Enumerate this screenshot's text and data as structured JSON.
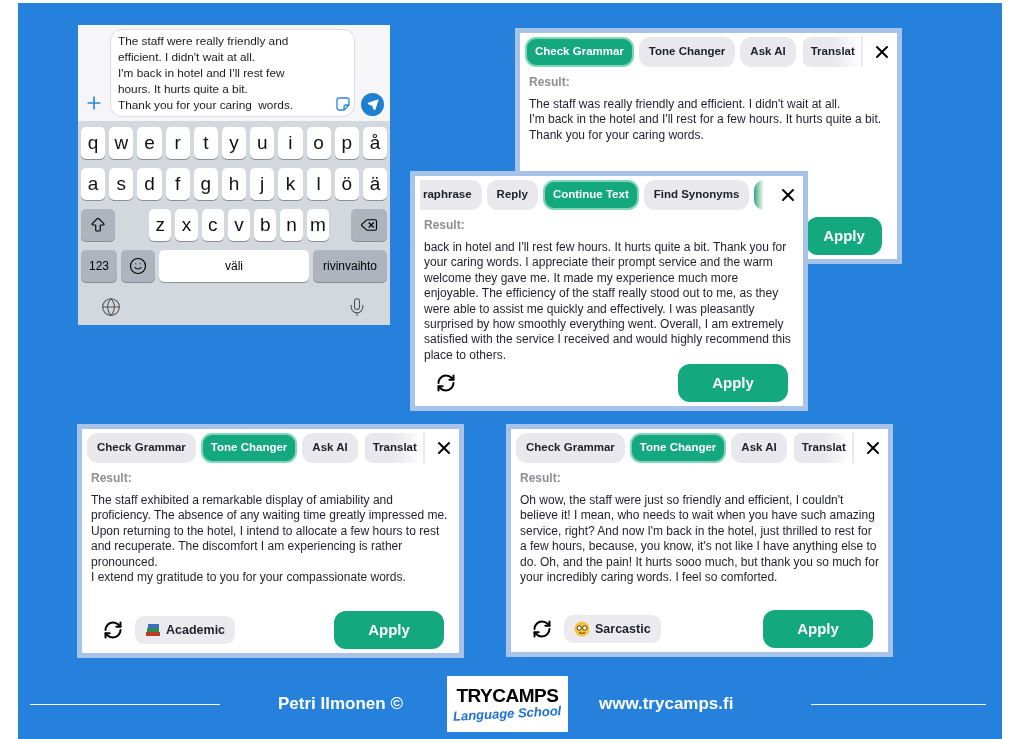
{
  "phone": {
    "message_lines": [
      "The staff were really friendly and",
      "efficient. I didn't wait at all.",
      "I'm back in hotel and I'll rest few",
      "hours. It hurts quite a bit.",
      "Thank you for your caring  words."
    ],
    "keyboard": [
      [
        {
          "kind": "letter",
          "label": "q"
        },
        {
          "kind": "letter",
          "label": "w"
        },
        {
          "kind": "letter",
          "label": "e"
        },
        {
          "kind": "letter",
          "label": "r"
        },
        {
          "kind": "letter",
          "label": "t"
        },
        {
          "kind": "letter",
          "label": "y"
        },
        {
          "kind": "letter",
          "label": "u"
        },
        {
          "kind": "letter",
          "label": "i"
        },
        {
          "kind": "letter",
          "label": "o"
        },
        {
          "kind": "letter",
          "label": "p"
        },
        {
          "kind": "letter",
          "label": "å"
        }
      ],
      [
        {
          "kind": "letter",
          "label": "a"
        },
        {
          "kind": "letter",
          "label": "s"
        },
        {
          "kind": "letter",
          "label": "d"
        },
        {
          "kind": "letter",
          "label": "f"
        },
        {
          "kind": "letter",
          "label": "g"
        },
        {
          "kind": "letter",
          "label": "h"
        },
        {
          "kind": "letter",
          "label": "j"
        },
        {
          "kind": "letter",
          "label": "k"
        },
        {
          "kind": "letter",
          "label": "l"
        },
        {
          "kind": "letter",
          "label": "ö"
        },
        {
          "kind": "letter",
          "label": "ä"
        }
      ],
      [
        {
          "kind": "shift"
        },
        {
          "kind": "letter",
          "label": "z"
        },
        {
          "kind": "letter",
          "label": "x"
        },
        {
          "kind": "letter",
          "label": "c"
        },
        {
          "kind": "letter",
          "label": "v"
        },
        {
          "kind": "letter",
          "label": "b"
        },
        {
          "kind": "letter",
          "label": "n"
        },
        {
          "kind": "letter",
          "label": "m"
        },
        {
          "kind": "backspace"
        }
      ],
      [
        {
          "kind": "numbers",
          "label": "123"
        },
        {
          "kind": "emoji"
        },
        {
          "kind": "space",
          "label": "väli"
        },
        {
          "kind": "return",
          "label": "rivinvaihto"
        }
      ]
    ]
  },
  "panels": [
    {
      "tabs": [
        {
          "label": "Check Grammar",
          "selected": true,
          "kind": "full"
        },
        {
          "label": "Tone Changer",
          "selected": false,
          "kind": "full"
        },
        {
          "label": "Ask AI",
          "selected": false,
          "kind": "full"
        },
        {
          "label": "Translat",
          "selected": false,
          "kind": "cut_right"
        }
      ],
      "result_label": "Result:",
      "result": "The staff was really friendly and efficient. I didn't wait at all.\nI'm back in the hotel and I'll rest for a few hours. It hurts quite a bit.\nThank you for your caring words.",
      "apply": "Apply"
    },
    {
      "tabs": [
        {
          "label": "raphrase",
          "selected": false,
          "kind": "cut_left"
        },
        {
          "label": "Reply",
          "selected": false,
          "kind": "full"
        },
        {
          "label": "Continue Text",
          "selected": true,
          "kind": "full"
        },
        {
          "label": "Find Synonyms",
          "selected": false,
          "kind": "full"
        }
      ],
      "result_label": "Result:",
      "result": "back in hotel and I'll rest few hours. It hurts quite a bit. Thank you for your caring words. I appreciate their prompt service and the warm welcome they gave me. It made my experience much more enjoyable. The efficiency of the staff really stood out to me, as they were able to assist me quickly and effectively. I was pleasantly surprised by how smoothly everything went. Overall, I am extremely satisfied with the service I received and would highly recommend this place to others.",
      "refresh": true,
      "apply": "Apply"
    },
    {
      "tabs": [
        {
          "label": "Check Grammar",
          "selected": false,
          "kind": "full"
        },
        {
          "label": "Tone Changer",
          "selected": true,
          "kind": "full"
        },
        {
          "label": "Ask AI",
          "selected": false,
          "kind": "full"
        },
        {
          "label": "Translat",
          "selected": false,
          "kind": "cut_right"
        }
      ],
      "result_label": "Result:",
      "result": "The staff exhibited a remarkable display of amiability and proficiency. The absence of any waiting time greatly impressed me. Upon returning to the hotel, I intend to allocate a few hours to rest and recuperate. The discomfort I am experiencing is rather pronounced.\nI extend my gratitude to you for your compassionate words.",
      "refresh": true,
      "tone": {
        "kind": "books",
        "label": "Academic"
      },
      "apply": "Apply"
    },
    {
      "tabs": [
        {
          "label": "Check Grammar",
          "selected": false,
          "kind": "full"
        },
        {
          "label": "Tone Changer",
          "selected": true,
          "kind": "full"
        },
        {
          "label": "Ask AI",
          "selected": false,
          "kind": "full"
        },
        {
          "label": "Translat",
          "selected": false,
          "kind": "cut_right"
        }
      ],
      "result_label": "Result:",
      "result": "Oh wow, the staff were just so friendly and efficient, I couldn't believe it! I mean, who needs to wait when you have such amazing service, right? And now I'm back in the hotel, just thrilled to rest for a few hours, because, you know, it's not like I have anything else to do. Oh, and the pain! It hurts sooo much, but thank you so much for your incredibly caring words. I feel so comforted.",
      "refresh": true,
      "tone": {
        "kind": "nerd",
        "label": "Sarcastic"
      },
      "apply": "Apply"
    }
  ],
  "footer": {
    "author": "Petri Ilmonen ©",
    "logo_title": "TRYCAMPS",
    "logo_subtitle": "Language School",
    "website": "www.trycamps.fi"
  }
}
